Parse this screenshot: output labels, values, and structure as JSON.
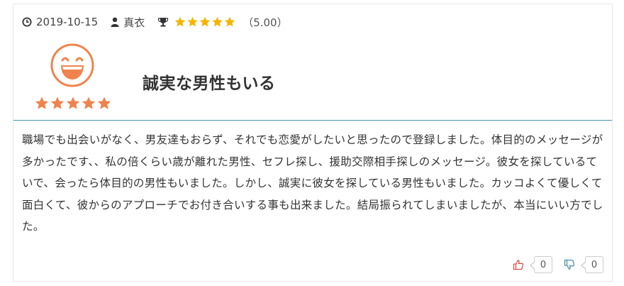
{
  "review": {
    "date": "2019-10-15",
    "author": "真衣",
    "rating": 5,
    "score_text": "（5.00）",
    "title": "誠実な男性もいる",
    "body": "職場でも出会いがなく、男友達もおらず、それでも恋愛がしたいと思ったので登録しました。体目的のメッセージが多かったです、、私の倍くらい歳が離れた男性、セフレ探し、援助交際相手探しのメッセージ。彼女を探しているていで、会ったら体目的の男性もいました。しかし、誠実に彼女を探している男性もいました。カッコよくて優しくて面白くて、彼からのアプローチでお付き合いする事も出来ました。結局振られてしまいましたが、本当にいい方でした。"
  },
  "votes": {
    "up_count": "0",
    "down_count": "0"
  },
  "icons": {
    "date": "clock-icon",
    "author": "user-icon",
    "rating": "trophy-icon",
    "face": "laughing-face-icon",
    "up": "thumbs-up-icon",
    "down": "thumbs-down-icon"
  },
  "colors": {
    "meta_star": "#f5b400",
    "rating_star": "#f0834d",
    "face": "#f0834d",
    "thumb_up": "#d9534f",
    "thumb_down": "#4a90b0",
    "divider": "#4a90b0"
  }
}
